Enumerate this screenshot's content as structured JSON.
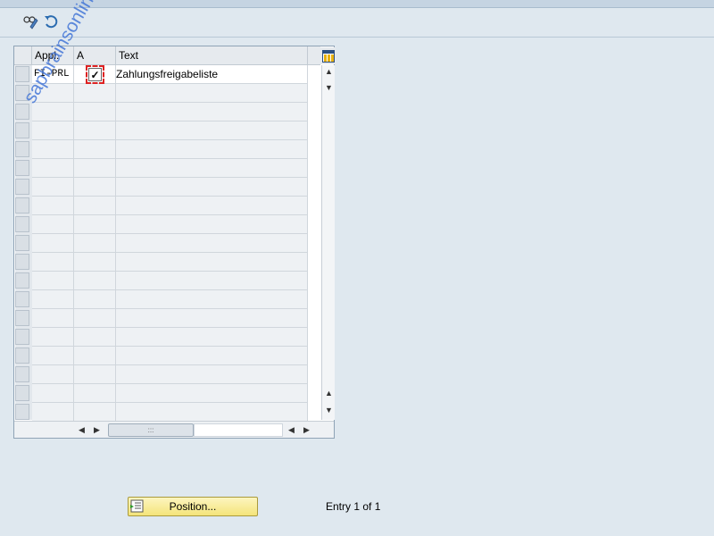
{
  "toolbar": {
    "buttons": [
      {
        "icon": "display-change-icon"
      },
      {
        "icon": "undo-icon"
      }
    ]
  },
  "table": {
    "columns": [
      {
        "label": "Appl."
      },
      {
        "label": "A"
      },
      {
        "label": "Text"
      }
    ],
    "rows": [
      {
        "appl": "FI-PRL",
        "a_checked": true,
        "text": "Zahlungsfreigabeliste"
      }
    ],
    "empty_rows": 18
  },
  "watermark": "sapbrainsonline.com",
  "footer": {
    "position_button": "Position...",
    "entry_info": "Entry 1 of 1"
  },
  "colors": {
    "background": "#dfe8ef",
    "button": "#f4e47a",
    "watermark": "#3a6fd6"
  }
}
